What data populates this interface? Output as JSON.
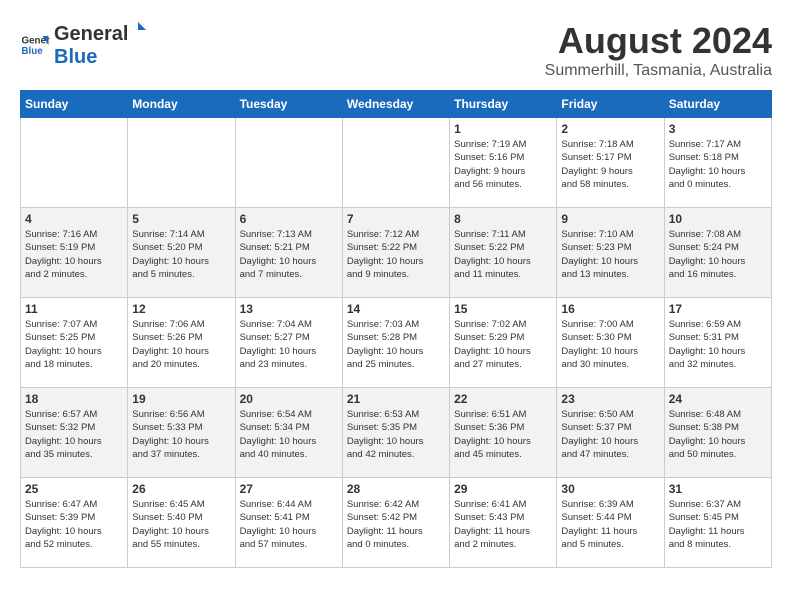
{
  "header": {
    "logo_general": "General",
    "logo_blue": "Blue",
    "title": "August 2024",
    "subtitle": "Summerhill, Tasmania, Australia"
  },
  "days_of_week": [
    "Sunday",
    "Monday",
    "Tuesday",
    "Wednesday",
    "Thursday",
    "Friday",
    "Saturday"
  ],
  "weeks": [
    [
      {
        "day": "",
        "info": ""
      },
      {
        "day": "",
        "info": ""
      },
      {
        "day": "",
        "info": ""
      },
      {
        "day": "",
        "info": ""
      },
      {
        "day": "1",
        "info": "Sunrise: 7:19 AM\nSunset: 5:16 PM\nDaylight: 9 hours\nand 56 minutes."
      },
      {
        "day": "2",
        "info": "Sunrise: 7:18 AM\nSunset: 5:17 PM\nDaylight: 9 hours\nand 58 minutes."
      },
      {
        "day": "3",
        "info": "Sunrise: 7:17 AM\nSunset: 5:18 PM\nDaylight: 10 hours\nand 0 minutes."
      }
    ],
    [
      {
        "day": "4",
        "info": "Sunrise: 7:16 AM\nSunset: 5:19 PM\nDaylight: 10 hours\nand 2 minutes."
      },
      {
        "day": "5",
        "info": "Sunrise: 7:14 AM\nSunset: 5:20 PM\nDaylight: 10 hours\nand 5 minutes."
      },
      {
        "day": "6",
        "info": "Sunrise: 7:13 AM\nSunset: 5:21 PM\nDaylight: 10 hours\nand 7 minutes."
      },
      {
        "day": "7",
        "info": "Sunrise: 7:12 AM\nSunset: 5:22 PM\nDaylight: 10 hours\nand 9 minutes."
      },
      {
        "day": "8",
        "info": "Sunrise: 7:11 AM\nSunset: 5:22 PM\nDaylight: 10 hours\nand 11 minutes."
      },
      {
        "day": "9",
        "info": "Sunrise: 7:10 AM\nSunset: 5:23 PM\nDaylight: 10 hours\nand 13 minutes."
      },
      {
        "day": "10",
        "info": "Sunrise: 7:08 AM\nSunset: 5:24 PM\nDaylight: 10 hours\nand 16 minutes."
      }
    ],
    [
      {
        "day": "11",
        "info": "Sunrise: 7:07 AM\nSunset: 5:25 PM\nDaylight: 10 hours\nand 18 minutes."
      },
      {
        "day": "12",
        "info": "Sunrise: 7:06 AM\nSunset: 5:26 PM\nDaylight: 10 hours\nand 20 minutes."
      },
      {
        "day": "13",
        "info": "Sunrise: 7:04 AM\nSunset: 5:27 PM\nDaylight: 10 hours\nand 23 minutes."
      },
      {
        "day": "14",
        "info": "Sunrise: 7:03 AM\nSunset: 5:28 PM\nDaylight: 10 hours\nand 25 minutes."
      },
      {
        "day": "15",
        "info": "Sunrise: 7:02 AM\nSunset: 5:29 PM\nDaylight: 10 hours\nand 27 minutes."
      },
      {
        "day": "16",
        "info": "Sunrise: 7:00 AM\nSunset: 5:30 PM\nDaylight: 10 hours\nand 30 minutes."
      },
      {
        "day": "17",
        "info": "Sunrise: 6:59 AM\nSunset: 5:31 PM\nDaylight: 10 hours\nand 32 minutes."
      }
    ],
    [
      {
        "day": "18",
        "info": "Sunrise: 6:57 AM\nSunset: 5:32 PM\nDaylight: 10 hours\nand 35 minutes."
      },
      {
        "day": "19",
        "info": "Sunrise: 6:56 AM\nSunset: 5:33 PM\nDaylight: 10 hours\nand 37 minutes."
      },
      {
        "day": "20",
        "info": "Sunrise: 6:54 AM\nSunset: 5:34 PM\nDaylight: 10 hours\nand 40 minutes."
      },
      {
        "day": "21",
        "info": "Sunrise: 6:53 AM\nSunset: 5:35 PM\nDaylight: 10 hours\nand 42 minutes."
      },
      {
        "day": "22",
        "info": "Sunrise: 6:51 AM\nSunset: 5:36 PM\nDaylight: 10 hours\nand 45 minutes."
      },
      {
        "day": "23",
        "info": "Sunrise: 6:50 AM\nSunset: 5:37 PM\nDaylight: 10 hours\nand 47 minutes."
      },
      {
        "day": "24",
        "info": "Sunrise: 6:48 AM\nSunset: 5:38 PM\nDaylight: 10 hours\nand 50 minutes."
      }
    ],
    [
      {
        "day": "25",
        "info": "Sunrise: 6:47 AM\nSunset: 5:39 PM\nDaylight: 10 hours\nand 52 minutes."
      },
      {
        "day": "26",
        "info": "Sunrise: 6:45 AM\nSunset: 5:40 PM\nDaylight: 10 hours\nand 55 minutes."
      },
      {
        "day": "27",
        "info": "Sunrise: 6:44 AM\nSunset: 5:41 PM\nDaylight: 10 hours\nand 57 minutes."
      },
      {
        "day": "28",
        "info": "Sunrise: 6:42 AM\nSunset: 5:42 PM\nDaylight: 11 hours\nand 0 minutes."
      },
      {
        "day": "29",
        "info": "Sunrise: 6:41 AM\nSunset: 5:43 PM\nDaylight: 11 hours\nand 2 minutes."
      },
      {
        "day": "30",
        "info": "Sunrise: 6:39 AM\nSunset: 5:44 PM\nDaylight: 11 hours\nand 5 minutes."
      },
      {
        "day": "31",
        "info": "Sunrise: 6:37 AM\nSunset: 5:45 PM\nDaylight: 11 hours\nand 8 minutes."
      }
    ]
  ]
}
